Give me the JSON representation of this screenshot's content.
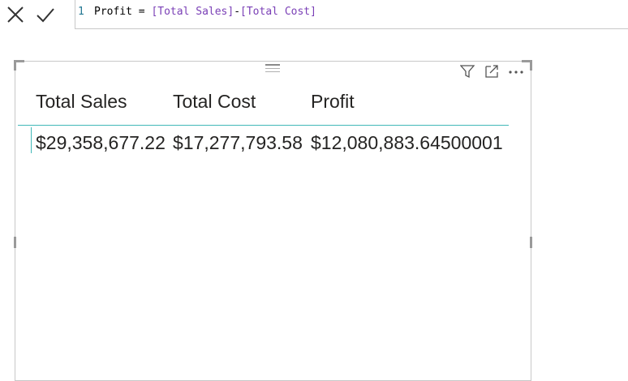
{
  "formula_bar": {
    "line_number": "1",
    "tokens": [
      {
        "text": "Profit = ",
        "kind": "plain"
      },
      {
        "text": "[Total Sales]",
        "kind": "ref"
      },
      {
        "text": "-",
        "kind": "plain"
      },
      {
        "text": "[Total Cost]",
        "kind": "ref"
      }
    ],
    "icons": {
      "cancel": "close-icon",
      "commit": "checkmark-icon"
    }
  },
  "visual": {
    "header_icons": [
      "filter-icon",
      "focus-mode-icon",
      "more-options-icon"
    ],
    "table": {
      "columns": [
        "Total Sales",
        "Total Cost",
        "Profit"
      ],
      "rows": [
        [
          "$29,358,677.22",
          "$17,277,793.58",
          "$12,080,883.64500001"
        ]
      ]
    }
  },
  "colors": {
    "accent_teal": "#41b8b8",
    "column_ref": "#7a3fb6",
    "line_number": "#237893",
    "text": "#252423"
  }
}
